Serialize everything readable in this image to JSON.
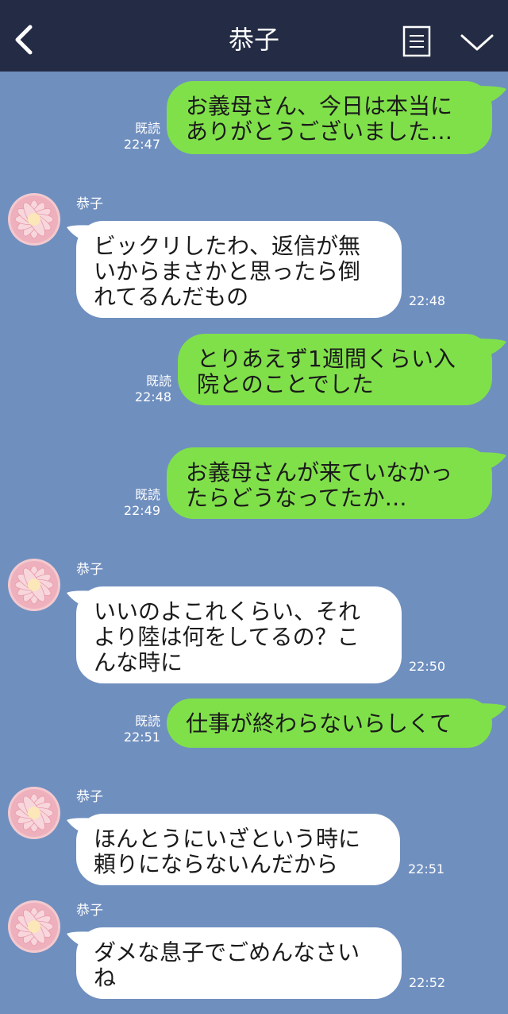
{
  "header": {
    "title": "恭子"
  },
  "messages": [
    {
      "side": "me",
      "text": "お義母さん、今日は本当に\nありがとうございました…",
      "read": "既読",
      "time": "22:47"
    },
    {
      "side": "them",
      "name": "恭子",
      "text": "ビックリしたわ、返信が無\nいからまさかと思ったら倒\nれてるんだもの",
      "time": "22:48"
    },
    {
      "side": "me",
      "text": "とりあえず1週間くらい入\n院とのことでした",
      "read": "既読",
      "time": "22:48"
    },
    {
      "side": "me",
      "text": "お義母さんが来ていなかっ\nたらどうなってたか…",
      "read": "既読",
      "time": "22:49"
    },
    {
      "side": "them",
      "name": "恭子",
      "text": "いいのよこれくらい、それ\nより陸は何をしてるの？こ\nんな時に",
      "time": "22:50"
    },
    {
      "side": "me",
      "text": "仕事が終わらないらしくて",
      "read": "既読",
      "time": "22:51"
    },
    {
      "side": "them",
      "name": "恭子",
      "text": "ほんとうにいざという時に\n頼りにならないんだから",
      "time": "22:51"
    },
    {
      "side": "them",
      "name": "恭子",
      "text": "ダメな息子でごめんなさい\nね",
      "time": "22:52"
    }
  ],
  "colors": {
    "header": "#232c44",
    "background": "#6f8fbf",
    "my_bubble": "#80e04a",
    "their_bubble": "#ffffff"
  },
  "icons": {
    "back": "chevron-left-icon",
    "menu": "list-icon",
    "collapse": "chevron-down-icon",
    "avatar": "flower-avatar"
  }
}
